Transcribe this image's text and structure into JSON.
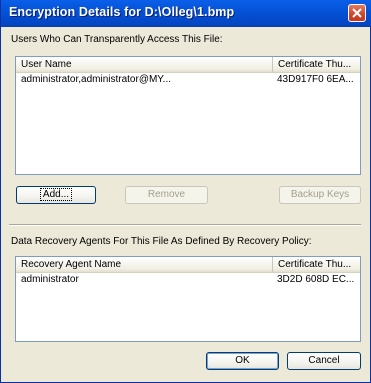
{
  "window": {
    "title": "Encryption Details for D:\\Olleg\\1.bmp",
    "close_icon": "close-icon"
  },
  "users": {
    "label": "Users Who Can Transparently Access This File:",
    "columns": [
      "User Name",
      "Certificate Thu..."
    ],
    "rows": [
      {
        "user": "administrator,administrator@MY...",
        "cert": "43D917F0 6EA..."
      }
    ],
    "buttons": {
      "add": "Add...",
      "remove": "Remove",
      "backup": "Backup Keys"
    }
  },
  "recovery": {
    "label": "Data Recovery Agents For This File As Defined By Recovery Policy:",
    "columns": [
      "Recovery Agent Name",
      "Certificate Thu..."
    ],
    "rows": [
      {
        "name": "administrator",
        "cert": "3D2D 608D EC..."
      }
    ]
  },
  "footer": {
    "ok": "OK",
    "cancel": "Cancel"
  },
  "colors": {
    "titlebar": "#0451d6",
    "close": "#d1442a",
    "face": "#ece9d8",
    "list_border": "#7f9db9"
  }
}
